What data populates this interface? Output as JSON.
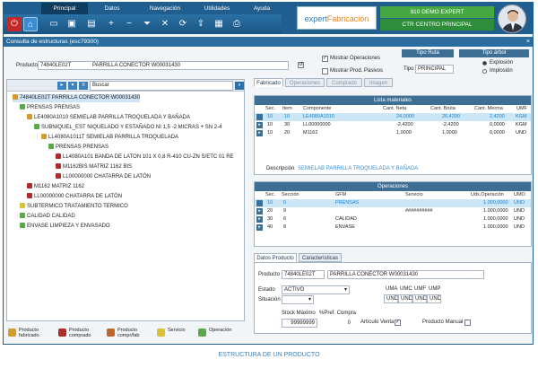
{
  "menu": [
    "Principal",
    "Datos",
    "Navegación",
    "Utilidades",
    "Ayuda"
  ],
  "header": {
    "logo_part1": "expert",
    "logo_part2": "Fabricación",
    "company": "910 DEMO EXPERT",
    "work_center": "CTR CENTRO PRINCIPAL"
  },
  "window": {
    "title": "Consulta de estructuras (esc79300)",
    "close": "×"
  },
  "product_filter": {
    "label": "Producto",
    "code": "74840LE02T",
    "name": "PARRILLA CONECTOR W00031430",
    "show_ops": "Mostrar Operaciones",
    "show_ops_checked": true,
    "show_passive": "Mostrar Prod. Pasivos",
    "show_passive_checked": false,
    "route_type_header": "Tipo Ruta",
    "route_type_label": "Tipo",
    "route_type_value": "PRINCIPAL",
    "tree_type_header": "Tipo árbol",
    "tree_options": [
      "Explosión",
      "Implosión"
    ],
    "tree_selected": "Explosión"
  },
  "tree": {
    "search_label": "Buscar",
    "nodes": [
      {
        "text": "74840LE02T   PARRILLA CONECTOR W00031430",
        "depth": 0,
        "icon": "product",
        "selected": true
      },
      {
        "text": "PRENSAS   PRENSAS",
        "depth": 1,
        "icon": "operation"
      },
      {
        "text": "LE4080A1010   SEMIELAB PARRILLA TROQUELADA Y BAÑADA",
        "depth": 2,
        "icon": "product"
      },
      {
        "text": "SUBNIQUEL_EST   NIQUELADO Y ESTAÑADO NI 1,5 -2 MICRAS + SN 2-4",
        "depth": 3,
        "icon": "operation"
      },
      {
        "text": "LL4080A1011T   SEMIELAB PARRILLA TROQUELADA",
        "depth": 4,
        "icon": "product"
      },
      {
        "text": "PRENSAS   PRENSAS",
        "depth": 5,
        "icon": "operation"
      },
      {
        "text": "LL4080A101   BANDA DE LATON 101 X 0,8 R-410 CU-ZN S/ETC 01 RE",
        "depth": 6,
        "icon": "purchased"
      },
      {
        "text": "M1162BIS   MATRIZ 1162 BIS",
        "depth": 6,
        "icon": "purchased"
      },
      {
        "text": "LL00000000   CHATARRA DE LATÓN",
        "depth": 6,
        "icon": "purchased"
      },
      {
        "text": "M1162   MATRIZ 1162",
        "depth": 2,
        "icon": "purchased"
      },
      {
        "text": "LL00000000   CHATARRA DE LATÓN",
        "depth": 2,
        "icon": "purchased"
      },
      {
        "text": "SUBTERMICO   TRATAMIENTO TERMICO",
        "depth": 1,
        "icon": "service"
      },
      {
        "text": "CALIDAD   CALIDAD",
        "depth": 1,
        "icon": "operation"
      },
      {
        "text": "ENVASE   LIMPIEZA Y ENVASADO",
        "depth": 1,
        "icon": "operation"
      }
    ]
  },
  "legend": [
    {
      "label": "Producto fabricado",
      "icon": "factory-product-icon",
      "color": "#d49a2a"
    },
    {
      "label": "Producto comprado",
      "icon": "purchased-product-icon",
      "color": "#b22a2a"
    },
    {
      "label": "Producto compr/fab",
      "icon": "bought-made-product-icon",
      "color": "#c0662a"
    },
    {
      "label": "Servicio",
      "icon": "service-icon",
      "color": "#d9c23a"
    },
    {
      "label": "Operación",
      "icon": "operation-icon",
      "color": "#5aa84a"
    }
  ],
  "right_tabs": [
    "Fabricado",
    "Operaciones",
    "Comprado",
    "Imagen"
  ],
  "right_tab_active": "Fabricado",
  "materials": {
    "title": "Lista materiales",
    "columns": [
      "Sec.",
      "Item",
      "Componente",
      "Cant. Neta",
      "Cant. Bruta",
      "Cant. Merma",
      "UMF"
    ],
    "rows": [
      {
        "sec": "10",
        "item": "10",
        "comp": "LE4080A1010",
        "neta": "24,0000",
        "bruta": "26,4200",
        "merma": "2,4200",
        "umf": "KGM",
        "selected": true
      },
      {
        "sec": "10",
        "item": "30",
        "comp": "LL00000000",
        "neta": "-2,4200",
        "bruta": "-2,4200",
        "merma": "0,0000",
        "umf": "KGM"
      },
      {
        "sec": "10",
        "item": "20",
        "comp": "M1162",
        "neta": "1,0000",
        "bruta": "1,0000",
        "merma": "0,0000",
        "umf": "UND"
      }
    ],
    "desc_label": "Descripción",
    "desc_value": "SEMIELAB PARRILLA TROQUELADA Y BAÑADA"
  },
  "operations": {
    "title": "Operaciones",
    "columns": [
      "Sec.",
      "Sección",
      "GFM",
      "Servicio",
      "Uds.Operación",
      "UMO"
    ],
    "rows": [
      {
        "sec": "10",
        "seccion": "0",
        "gfm": "PRENSAS",
        "servicio": "",
        "uds": "1.000,0000",
        "umo": "UND",
        "selected": true
      },
      {
        "sec": "20",
        "seccion": "9",
        "gfm": "",
        "servicio": "##########",
        "uds": "1.000,0000",
        "umo": "UND"
      },
      {
        "sec": "30",
        "seccion": "6",
        "gfm": "CALIDAD",
        "servicio": "",
        "uds": "1.000,0000",
        "umo": "UND"
      },
      {
        "sec": "40",
        "seccion": "8",
        "gfm": "ENVASE",
        "servicio": "",
        "uds": "1.000,0000",
        "umo": "UND"
      }
    ]
  },
  "bottom_tabs": [
    "Datos Producto",
    "Características"
  ],
  "product_data": {
    "product_label": "Producto",
    "code": "74840LE02T",
    "name": "PARRILLA CONECTOR W00031430",
    "status_label": "Estado",
    "status_value": "ACTIVO",
    "situation_label": "Situación",
    "situation_value": "",
    "units_headers": [
      "UMA",
      "UMC",
      "UMF",
      "UMP"
    ],
    "units_values": [
      "UND",
      "UND",
      "UND",
      "UND"
    ],
    "stock_label": "Stock Máximo",
    "stock_value": "99999999",
    "pref_label": "%Pref. Compra",
    "pref_value": "0",
    "sale_label": "Artículo Venta",
    "sale_checked": true,
    "manual_label": "Producto Manual",
    "manual_checked": false
  },
  "caption": "ESTRUCTURA DE UN PRODUCTO"
}
